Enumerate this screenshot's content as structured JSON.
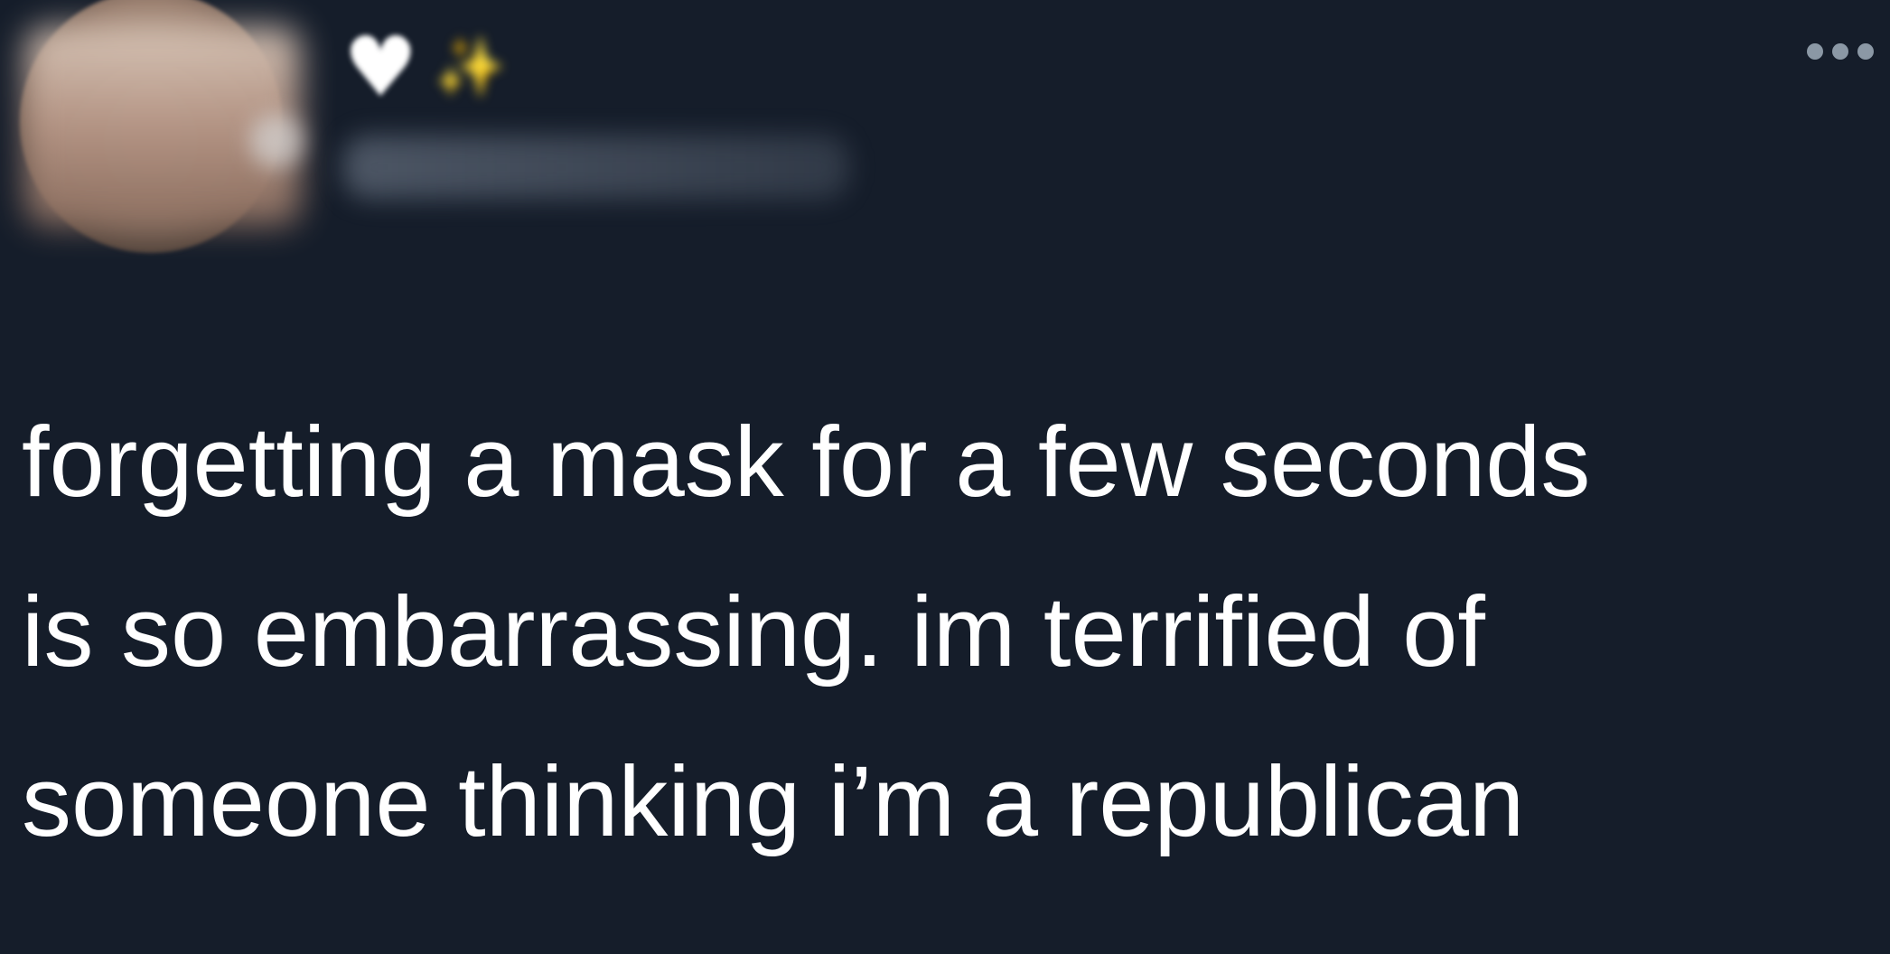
{
  "tweet": {
    "display_name_emojis": [
      "white-heart-emoji",
      "sparkles-emoji"
    ],
    "heart_glyph": "♥",
    "sparkle_glyph": "✨",
    "text_lines": [
      "forgetting a mask for a few seconds",
      "is so embarrassing. im terrified of",
      "someone thinking i’m a republican"
    ]
  },
  "icons": {
    "more": "more-options-icon"
  },
  "colors": {
    "background": "#151d2a",
    "text": "#ffffff",
    "icon_muted": "#8b98a5"
  }
}
